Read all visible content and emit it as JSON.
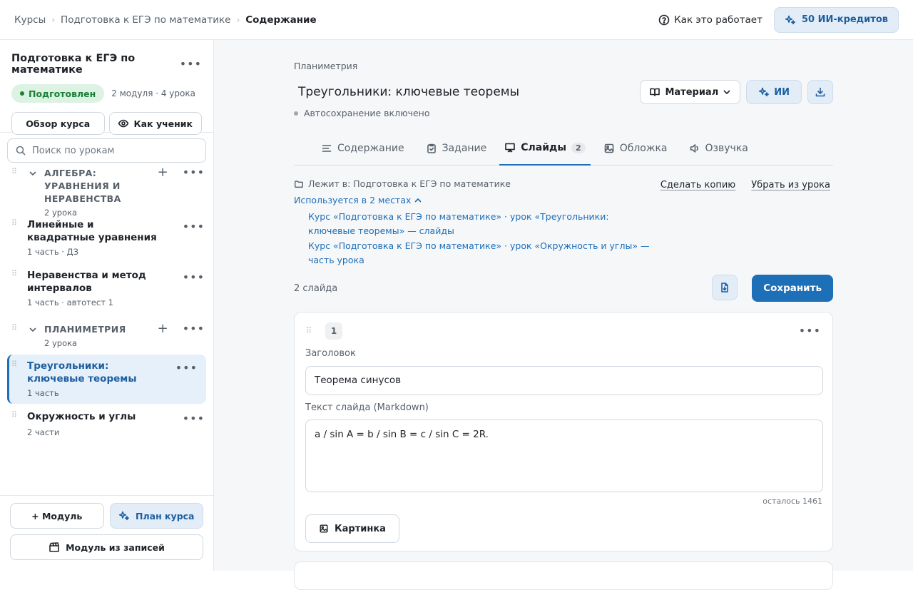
{
  "topbar": {
    "breadcrumbs": [
      "Курсы",
      "Подготовка к ЕГЭ по математике",
      "Содержание"
    ],
    "how_it_works": "Как это работает",
    "credits": "50 ИИ-кредитов"
  },
  "sidebar": {
    "course_title": "Подготовка к ЕГЭ по математике",
    "status": "Подготовлен",
    "summary": "2 модуля · 4 урока",
    "overview_btn": "Обзор курса",
    "student_btn": "Как ученик",
    "search_placeholder": "Поиск по урокам",
    "modules": [
      {
        "title": "АЛГЕБРА: УРАВНЕНИЯ И НЕРАВЕНСТВА",
        "sub": "2 урока",
        "lessons": [
          {
            "title": "Линейные и квадратные уравнения",
            "sub": "1 часть · ДЗ"
          },
          {
            "title": "Неравенства и метод интервалов",
            "sub": "1 часть · автотест 1"
          }
        ]
      },
      {
        "title": "ПЛАНИМЕТРИЯ",
        "sub": "2 урока",
        "lessons": [
          {
            "title": "Треугольники: ключевые теоремы",
            "sub": "1 часть"
          },
          {
            "title": "Окружность и углы",
            "sub": "2 части"
          }
        ]
      }
    ],
    "footer": {
      "add_module": "+ Модуль",
      "course_plan": "План курса",
      "module_from_recordings": "Модуль из записей"
    }
  },
  "main": {
    "kicker": "Планиметрия",
    "title": "Треугольники: ключевые теоремы",
    "autosave": "Автосохранение включено",
    "material_btn": "Материал",
    "ai_btn": "ИИ",
    "tabs": [
      {
        "label": "Содержание"
      },
      {
        "label": "Задание"
      },
      {
        "label": "Слайды",
        "count": "2"
      },
      {
        "label": "Обложка"
      },
      {
        "label": "Озвучка"
      }
    ],
    "location": "Лежит в: Подготовка к ЕГЭ по математике",
    "used_in": "Используется в 2 местах",
    "references": [
      "Курс «Подготовка к ЕГЭ по математике» · урок «Треугольники: ключевые теоремы» — слайды",
      "Курс «Подготовка к ЕГЭ по математике» · урок «Окружность и углы» — часть урока"
    ],
    "make_copy": "Сделать копию",
    "remove_from_lesson": "Убрать из урока",
    "slides_count": "2 слайда",
    "save_btn": "Сохранить",
    "slide": {
      "number": "1",
      "heading_label": "Заголовок",
      "heading_value": "Теорема синусов",
      "text_label": "Текст слайда (Markdown)",
      "text_value": "a / sin A = b / sin B = c / sin C = 2R.",
      "remaining": "осталось 1461",
      "image_btn": "Картинка"
    }
  },
  "colors": {
    "accent": "#1d6fb8",
    "accent_soft": "#e3edf7",
    "success": "#1a7f37"
  }
}
